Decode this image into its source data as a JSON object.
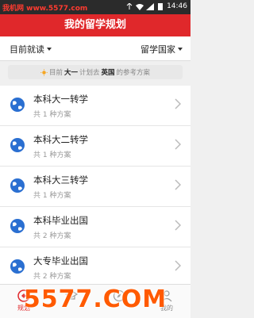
{
  "statusbar": {
    "brand": "我机网 www.5577.com",
    "time": "14:46"
  },
  "header": {
    "title": "我的留学规划"
  },
  "filters": {
    "current_study": "目前就读",
    "target_country": "留学国家"
  },
  "info": {
    "prefix": "目前",
    "grade": "大一",
    "mid": "计划去",
    "country": "英国",
    "suffix": "的参考方案"
  },
  "plans": [
    {
      "title": "本科大一转学",
      "subtitle": "共 1 种方案"
    },
    {
      "title": "本科大二转学",
      "subtitle": "共 1 种方案"
    },
    {
      "title": "本科大三转学",
      "subtitle": "共 1 种方案"
    },
    {
      "title": "本科毕业出国",
      "subtitle": "共 2 种方案"
    },
    {
      "title": "大专毕业出国",
      "subtitle": "共 2 种方案"
    }
  ],
  "tabs": [
    {
      "label": "规划",
      "icon": "plan-icon",
      "active": true
    },
    {
      "label": "",
      "icon": "school-icon"
    },
    {
      "label": "",
      "icon": "discover-icon"
    },
    {
      "label": "我的",
      "icon": "user-icon"
    }
  ],
  "watermark": "5577.COM",
  "colors": {
    "accent": "#e0282b",
    "watermark": "#ff5a00"
  }
}
